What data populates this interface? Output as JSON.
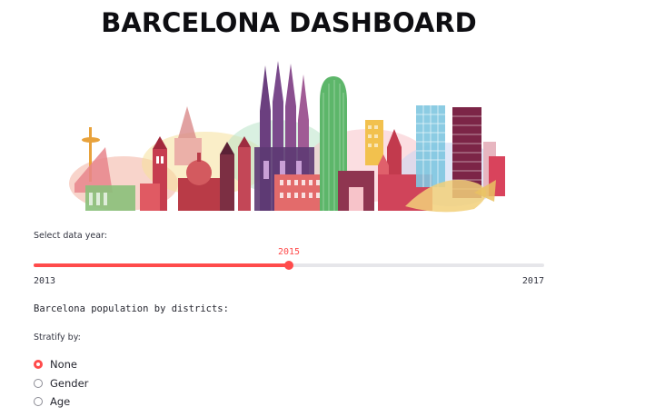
{
  "header": {
    "title": "BARCELONA DASHBOARD"
  },
  "banner": {
    "image": "barcelona-skyline-illustration"
  },
  "year_slider": {
    "label": "Select data year:",
    "min": 2013,
    "max": 2017,
    "value": 2015,
    "min_label": "2013",
    "max_label": "2017",
    "value_label": "2015",
    "accent_color": "#ff4b4b"
  },
  "section": {
    "text": "Barcelona population by districts:"
  },
  "stratify": {
    "label": "Stratify by:",
    "options": [
      {
        "label": "None",
        "selected": true
      },
      {
        "label": "Gender",
        "selected": false
      },
      {
        "label": "Age",
        "selected": false
      }
    ]
  }
}
